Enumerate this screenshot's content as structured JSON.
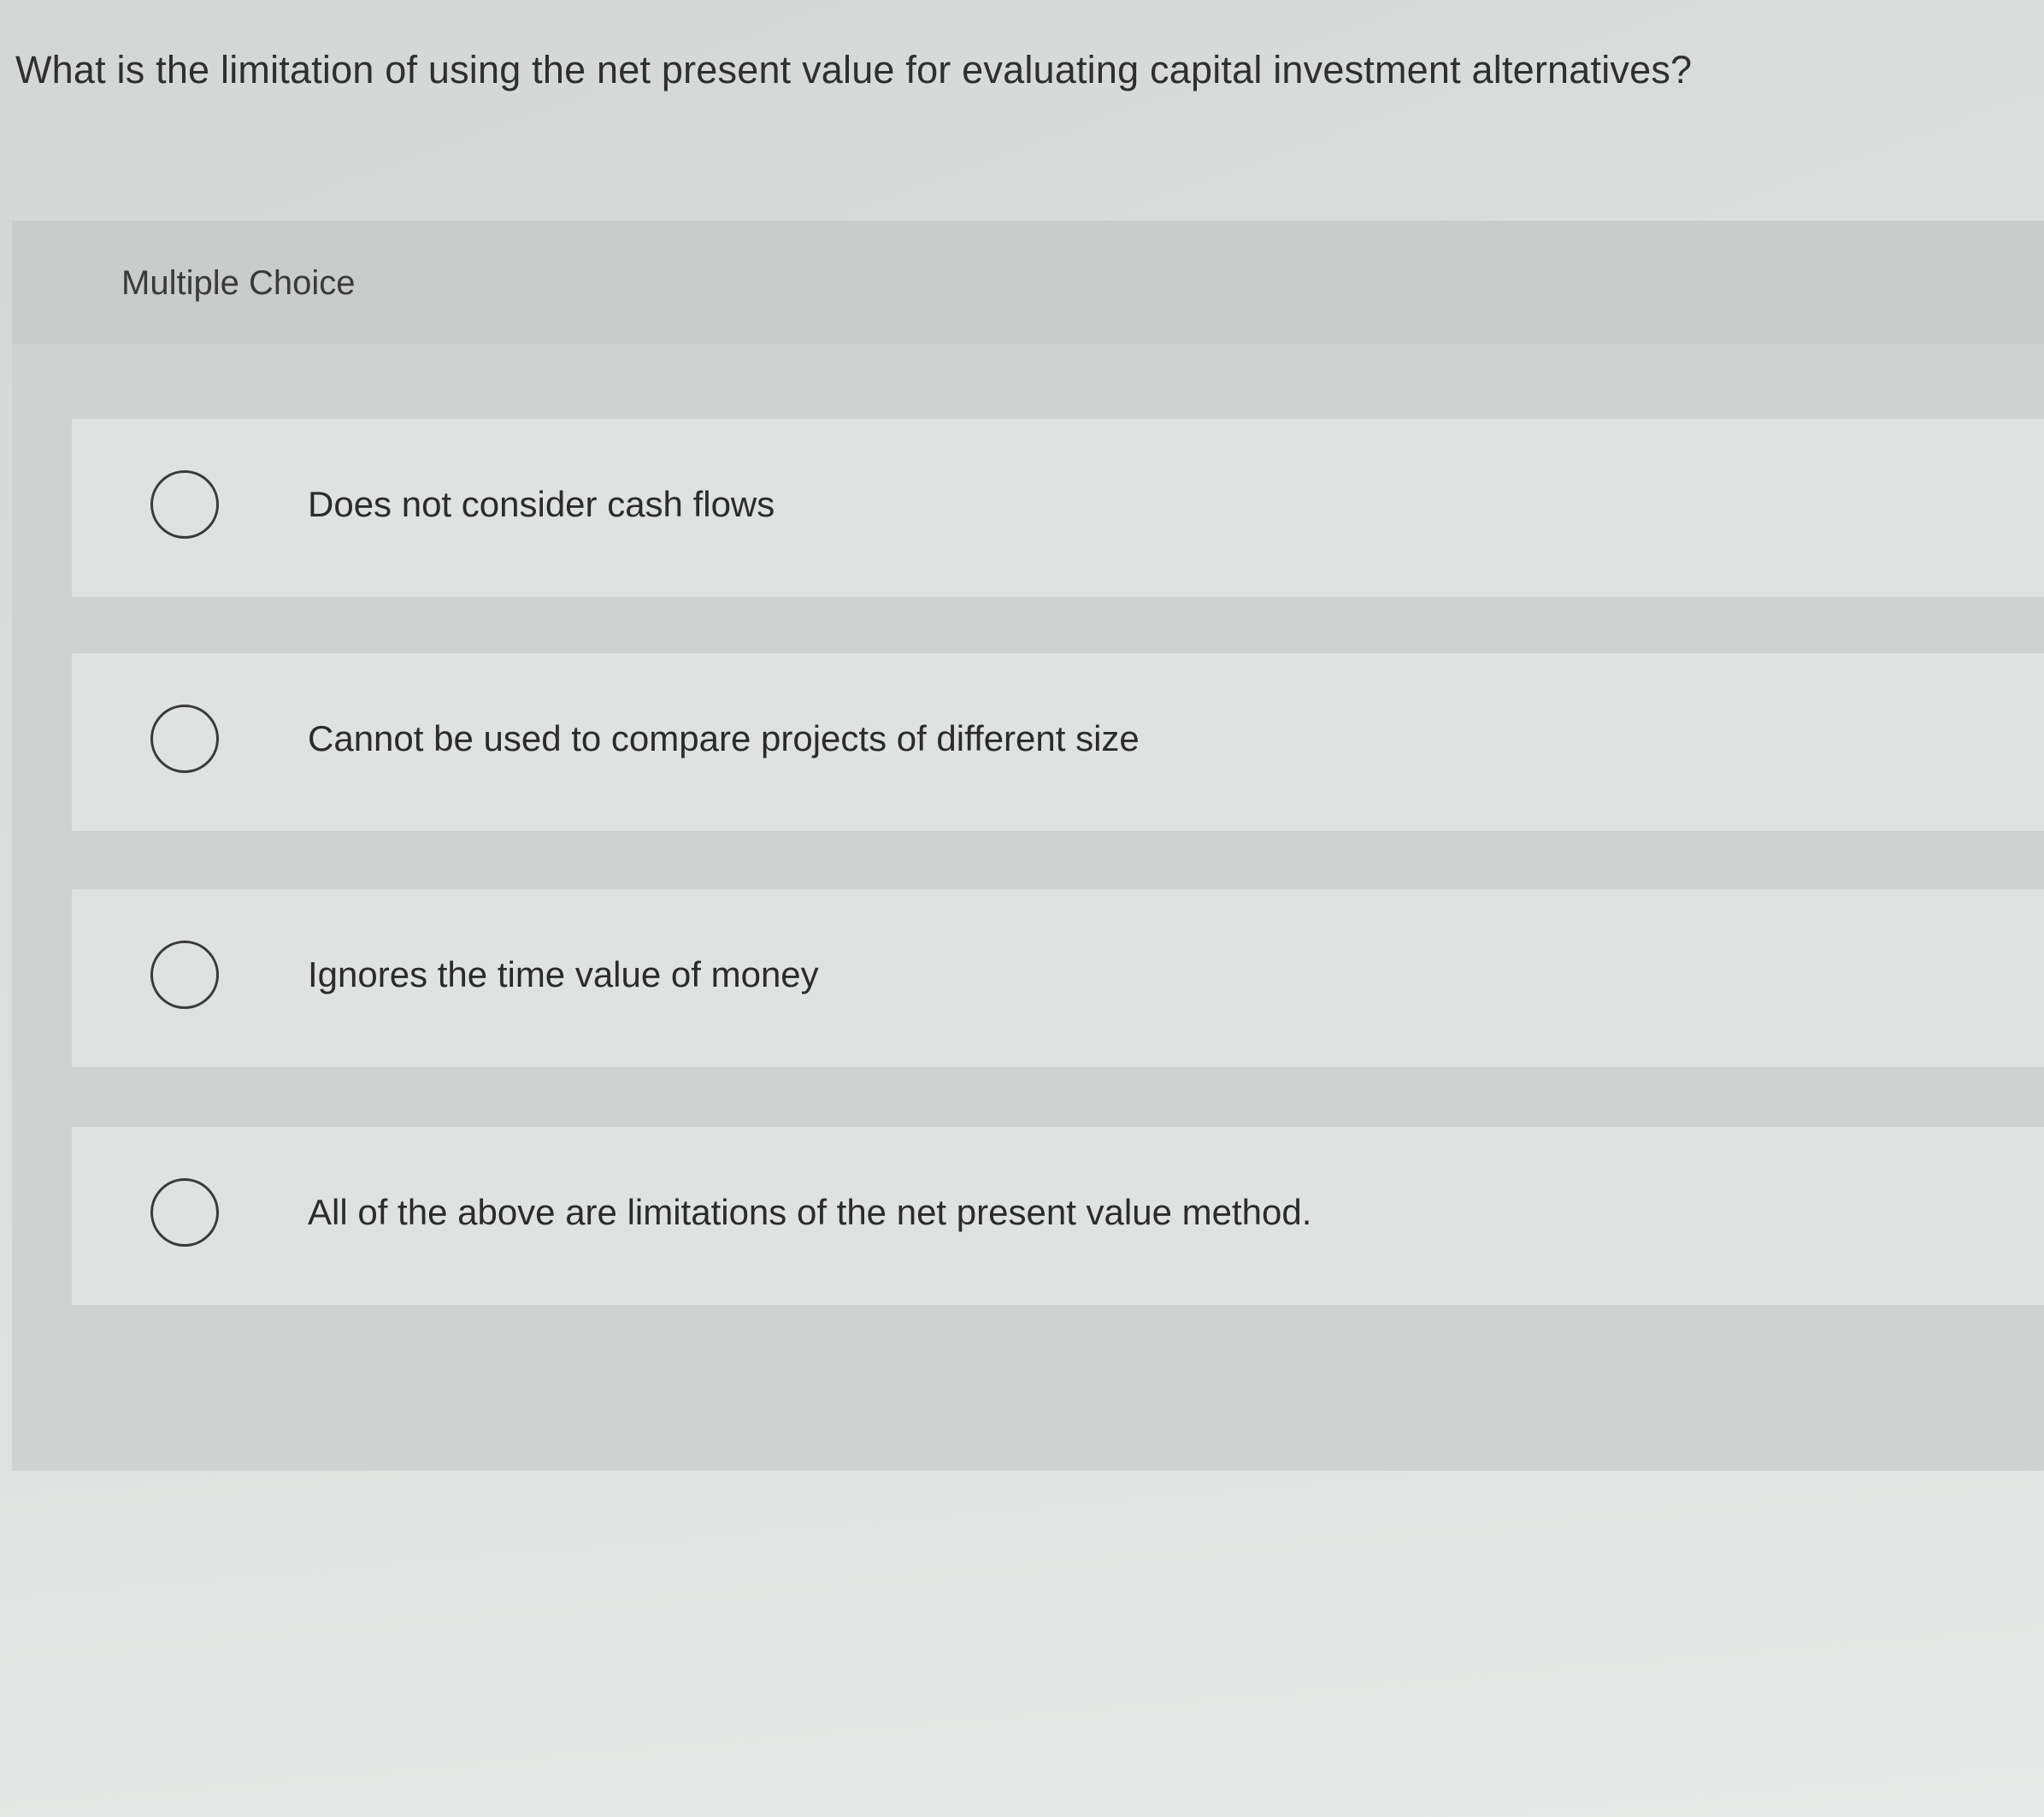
{
  "question": {
    "text": "What is the limitation of using the net present value for evaluating capital investment alternatives?"
  },
  "multiple_choice": {
    "label": "Multiple Choice",
    "options": [
      {
        "label": "Does not consider cash flows",
        "selected": false
      },
      {
        "label": "Cannot be used to compare projects of different size",
        "selected": false
      },
      {
        "label": "Ignores the time value of money",
        "selected": false
      },
      {
        "label": "All of the above are limitations of the net present value method.",
        "selected": false
      }
    ]
  },
  "colors": {
    "background": "#d8dbda",
    "panel": "#cfd2d1",
    "option_row": "#dfe2e1",
    "text": "#2b2b2b",
    "radio_border": "#3a3a3a"
  },
  "icons": {
    "radio": "radio-unchecked-icon"
  }
}
